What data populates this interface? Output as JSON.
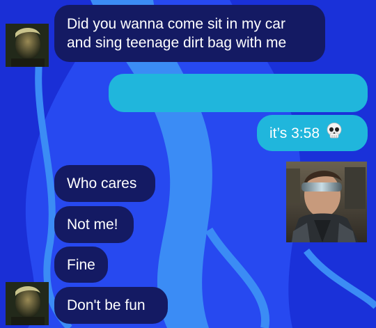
{
  "colors": {
    "background": "#2749f0",
    "background_swirl": "#1a2fd6",
    "swirl_light": "#3b8cf5",
    "incoming_bubble": "#141a63",
    "outgoing_bubble": "#20b6dc"
  },
  "messages": [
    {
      "sender": "left",
      "text": "Did you wanna come sit in my car\nand sing teenage dirt bag with me"
    },
    {
      "sender": "right",
      "text": ""
    },
    {
      "sender": "right",
      "text": "it’s 3:58",
      "emoji": "skull-icon"
    },
    {
      "sender": "left",
      "text": "Who cares"
    },
    {
      "sender": "left",
      "text": "Not me!"
    },
    {
      "sender": "left",
      "text": "Fine"
    },
    {
      "sender": "left",
      "text": "Don't be fun"
    }
  ],
  "avatars": {
    "left": "avatar-left-character",
    "right": "avatar-right-character-visor"
  }
}
